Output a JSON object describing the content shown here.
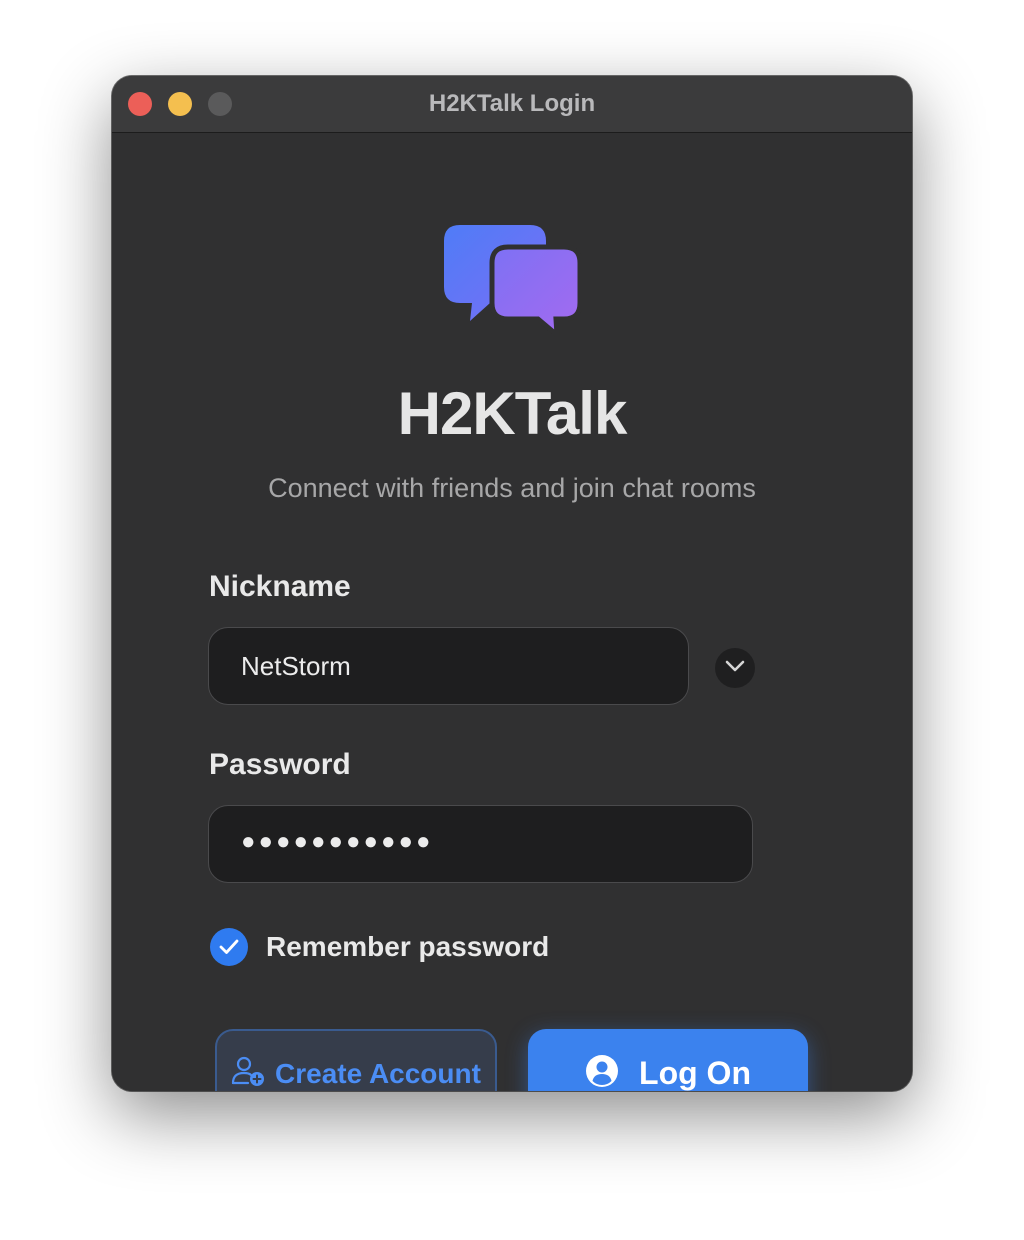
{
  "window": {
    "title": "H2KTalk Login"
  },
  "app": {
    "name": "H2KTalk",
    "tagline": "Connect with friends and join chat rooms",
    "logo_icon": "chat-bubbles-icon"
  },
  "form": {
    "nickname": {
      "label": "Nickname",
      "value": "NetStorm"
    },
    "password": {
      "label": "Password",
      "masked_value": "●●●●●●●●●●●"
    },
    "remember": {
      "label": "Remember password",
      "checked": true
    }
  },
  "buttons": {
    "create_account": {
      "label": "Create Account",
      "icon": "add-user-icon"
    },
    "log_on": {
      "label": "Log On",
      "icon": "user-circle-icon"
    }
  },
  "colors": {
    "accent": "#3b82ee",
    "logo_gradient_start": "#4f7cf7",
    "logo_gradient_end": "#9b6cf2",
    "traffic_close": "#ec5f58",
    "traffic_minimize": "#f4bf4f"
  }
}
